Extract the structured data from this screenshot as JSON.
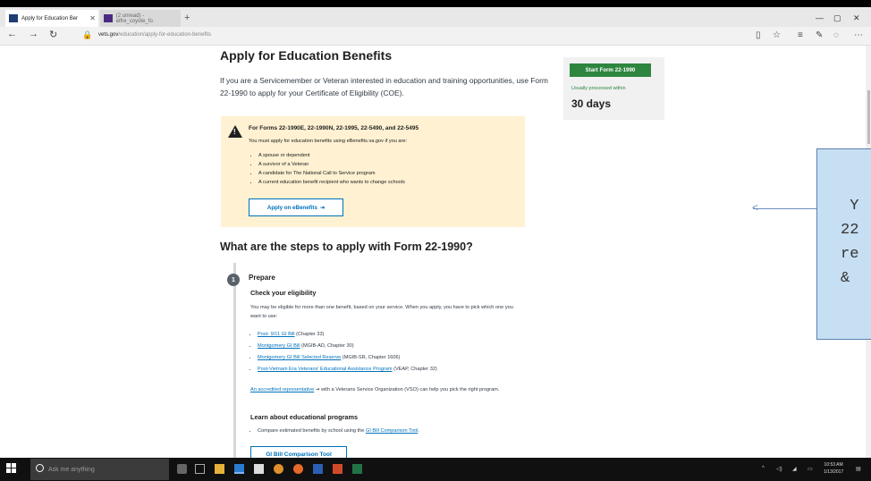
{
  "browser": {
    "tabs": [
      {
        "label": "Apply for Education Ber",
        "active": true
      },
      {
        "label": "(2 unread) - elfre_coyote_fo",
        "active": false
      }
    ],
    "new_tab": "+",
    "address": {
      "domain": "vets.gov",
      "path": "/education/apply-for-education-benefits"
    }
  },
  "page": {
    "title": "Apply for Education Benefits",
    "intro": "If you are a Servicemember or Veteran interested in education and training opportunities, use Form 22-1990 to apply for your Certificate of Eligibility (COE).",
    "sidebar": {
      "start_button": "Start Form 22-1990",
      "processed_label": "Usually processed within",
      "days": "30 days"
    },
    "alert": {
      "heading": "For Forms 22-1990E, 22-1990N, 22-1995, 22-5490, and 22-5495",
      "text": "You must apply for education benefits using eBenefits.va.gov if you are:",
      "items": [
        "A spouse or dependent",
        "A survivor of a Veteran",
        "A candidate for The National Call to Service program",
        "A current education benefit recipient who wants to change schools"
      ],
      "button": "Apply on eBenefits"
    },
    "steps_heading": "What are the steps to apply with Form 22-1990?",
    "step1": {
      "number": "1",
      "title": "Prepare",
      "check_heading": "Check your eligibility",
      "check_text": "You may be eligible for more than one benefit, based on your service. When you apply, you have to pick which one you want to use:",
      "benefits": [
        {
          "link": "Post- 9/11 GI Bill",
          "rest": " (Chapter 33)"
        },
        {
          "link": "Montgomery GI Bill",
          "rest": " (MGIB-AD, Chapter 30)"
        },
        {
          "link": "Montgomery GI Bill Selected Reserve",
          "rest": " (MGIB-SR, Chapter 1606)"
        },
        {
          "link": "Post-Vietnam Era Veterans' Educational Assistance Program",
          "rest": " (VEAP, Chapter 32)"
        }
      ],
      "rep_link": "An accredited representative",
      "rep_text": " with a Veterans Service Organization (VSO) can help you pick the right program.",
      "learn_heading": "Learn about educational programs",
      "compare_text": "Compare estimated benefits by school using the ",
      "compare_link": "GI Bill Comparison Tool",
      "compare_end": ".",
      "tool_button": "GI Bill Comparison Tool"
    }
  },
  "callout": {
    "lines": [
      " Y",
      "22",
      "re",
      "& "
    ]
  },
  "taskbar": {
    "search_placeholder": "Ask me anything",
    "time": "10:53 AM",
    "date": "1/13/2017"
  },
  "colors": {
    "accent_green": "#2e8540",
    "link_blue": "#0071bb",
    "alert_bg": "#fff1d2",
    "callout_bg": "#c7dff2"
  }
}
